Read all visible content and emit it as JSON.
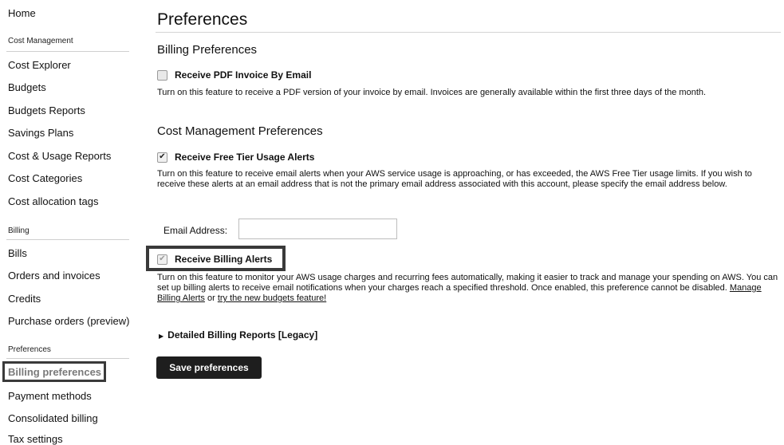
{
  "sidebar": {
    "home": "Home",
    "sections": [
      {
        "title": "Cost Management",
        "items": [
          "Cost Explorer",
          "Budgets",
          "Budgets Reports",
          "Savings Plans",
          "Cost & Usage Reports",
          "Cost Categories",
          "Cost allocation tags"
        ]
      },
      {
        "title": "Billing",
        "items": [
          "Bills",
          "Orders and invoices",
          "Credits",
          "Purchase orders (preview)"
        ]
      },
      {
        "title": "Preferences",
        "items": [
          "Billing preferences",
          "Payment methods",
          "Consolidated billing",
          "Tax settings"
        ]
      }
    ],
    "active_item": "Billing preferences"
  },
  "main": {
    "title": "Preferences",
    "billing_prefs": {
      "heading": "Billing Preferences",
      "pdf_invoice": {
        "label": "Receive PDF Invoice By Email",
        "checked": false,
        "description": "Turn on this feature to receive a PDF version of your invoice by email. Invoices are generally available within the first three days of the month."
      }
    },
    "cost_mgmt_prefs": {
      "heading": "Cost Management Preferences",
      "free_tier": {
        "label": "Receive Free Tier Usage Alerts",
        "checked": true,
        "description": "Turn on this feature to receive email alerts when your AWS service usage is approaching, or has exceeded, the AWS Free Tier usage limits. If you wish to receive these alerts at an email address that is not the primary email address associated with this account, please specify the email address below."
      },
      "email": {
        "label": "Email Address:",
        "value": "",
        "placeholder": ""
      },
      "billing_alerts": {
        "label": "Receive Billing Alerts",
        "checked": true,
        "disabled": true,
        "description": "Turn on this feature to monitor your AWS usage charges and recurring fees automatically, making it easier to track and manage your spending on AWS. You can set up billing alerts to receive email notifications when your charges reach a specified threshold. Once enabled, this preference cannot be disabled.",
        "link_manage": "Manage Billing Alerts",
        "link_connector": "or",
        "link_budgets": "try the new budgets feature!"
      }
    },
    "legacy_reports": "Detailed Billing Reports [Legacy]",
    "save_button": "Save preferences"
  },
  "icons": {
    "checkbox_checked": "checkmark-icon",
    "expand": "caret-right-icon"
  }
}
